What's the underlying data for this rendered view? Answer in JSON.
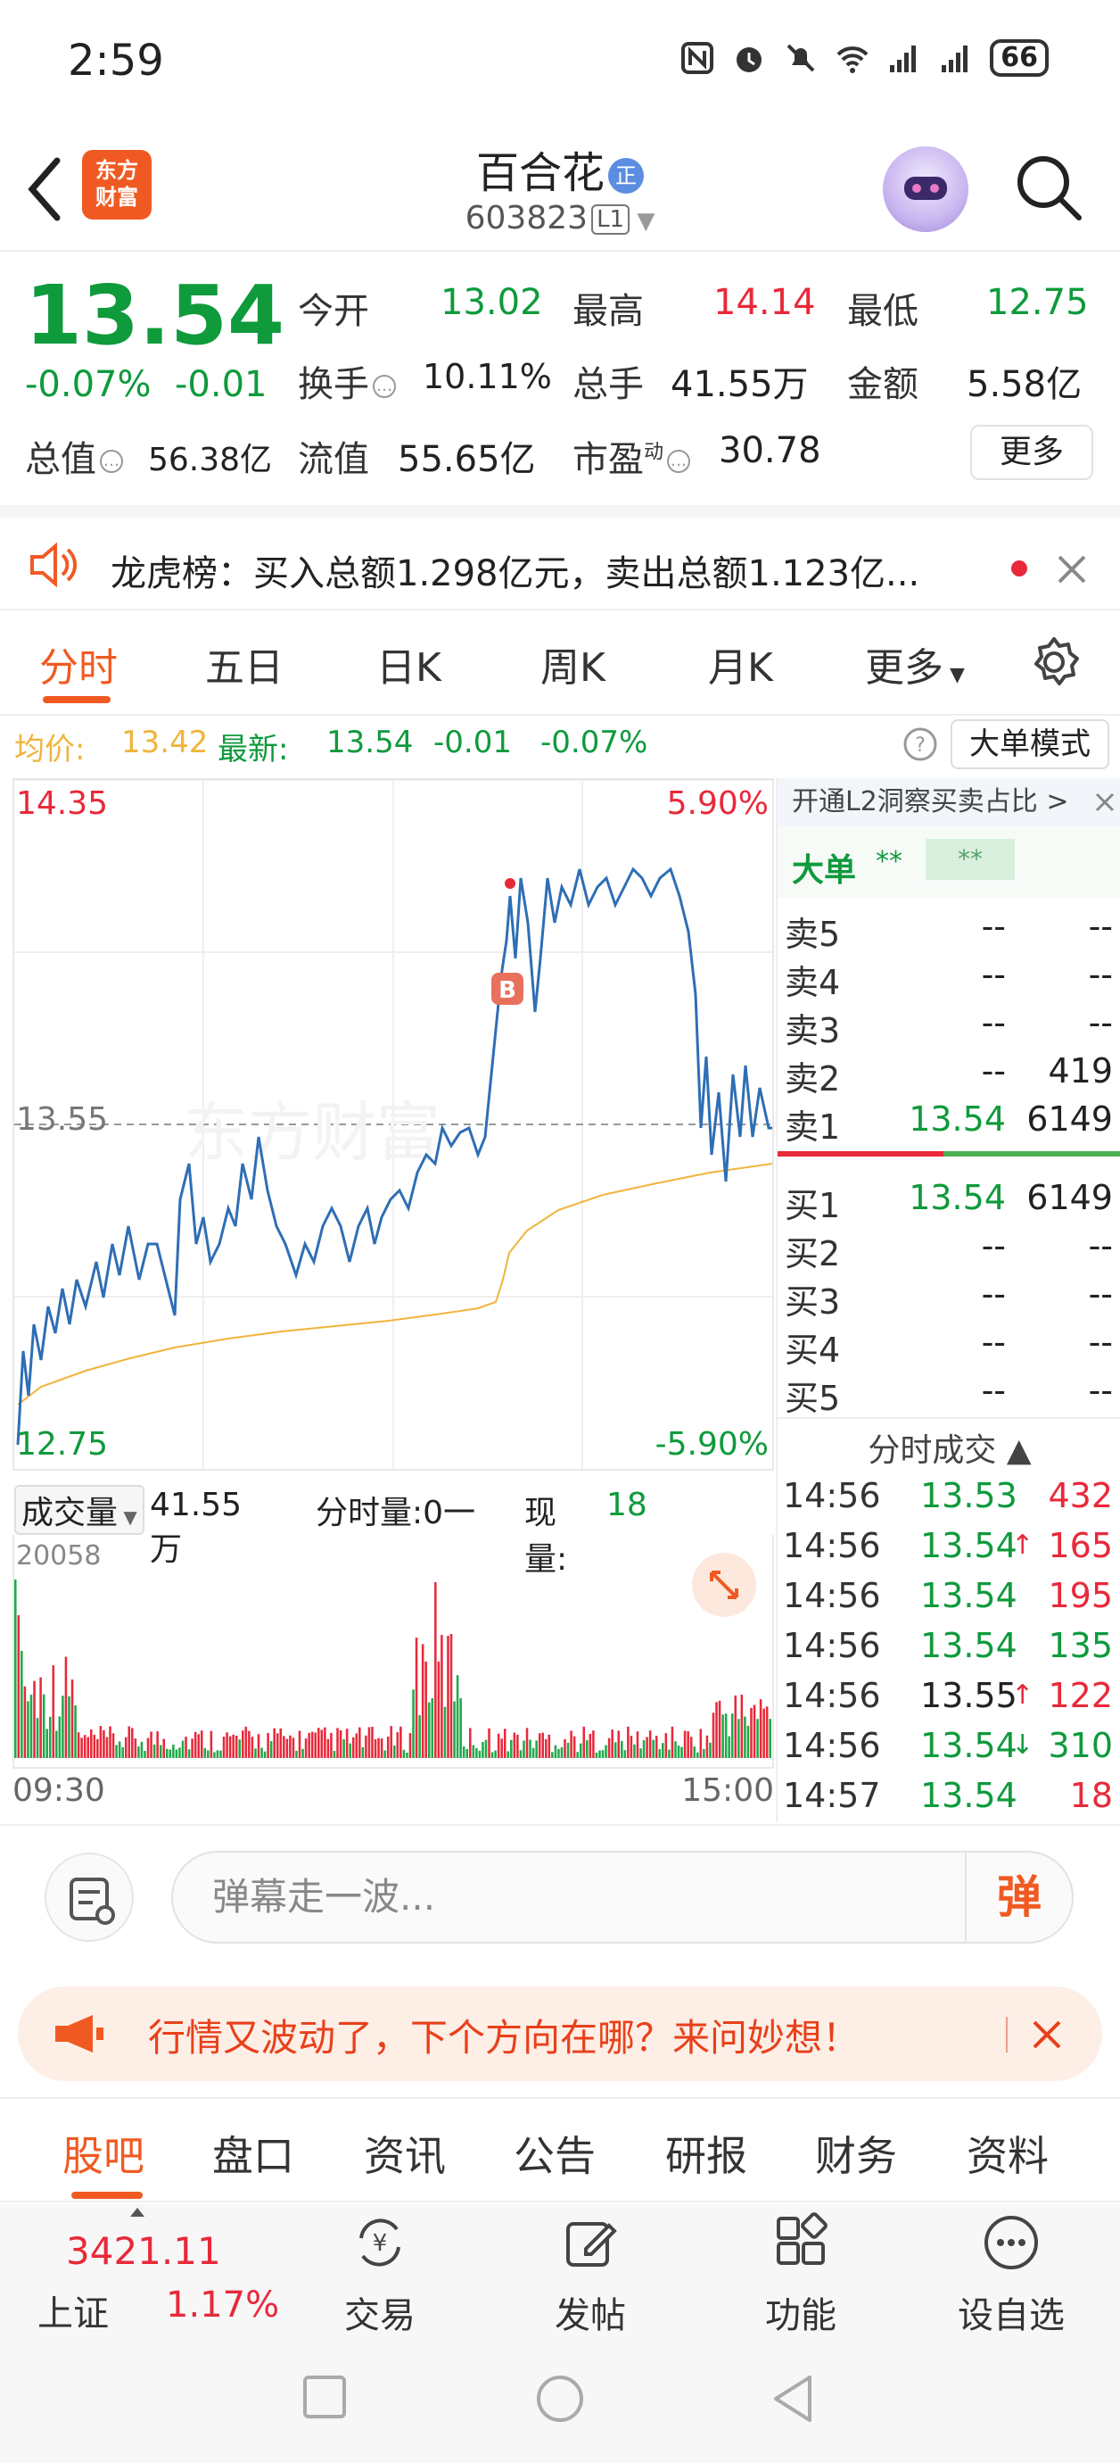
{
  "status_bar": {
    "time": "2:59",
    "battery": "66"
  },
  "header": {
    "stock_name": "百合花",
    "name_badge": "正",
    "stock_code": "603823",
    "level": "L1",
    "logo_text_line1": "东方",
    "logo_text_line2": "财富"
  },
  "quote": {
    "last_price": "13.54",
    "pct_change": "-0.07%",
    "abs_change": "-0.01",
    "open_label": "今开",
    "open": "13.02",
    "high_label": "最高",
    "high": "14.14",
    "low_label": "最低",
    "low": "12.75",
    "turnover_label": "换手",
    "turnover": "10.11%",
    "volume_label": "总手",
    "volume": "41.55万",
    "amount_label": "金额",
    "amount": "5.58亿",
    "mktcap_label": "总值",
    "mktcap": "56.38亿",
    "float_label": "流值",
    "float_cap": "55.65亿",
    "pe_label": "市盈",
    "pe_sup": "动",
    "pe": "30.78",
    "more_label": "更多"
  },
  "dragon_tiger": {
    "text": "龙虎榜：买入总额1.298亿元，卖出总额1.123亿..."
  },
  "chart_tabs": [
    "分时",
    "五日",
    "日K",
    "周K",
    "月K",
    "更多"
  ],
  "info_line": {
    "avg_label": "均价:",
    "avg": "13.42",
    "latest_label": "最新:",
    "latest": "13.54",
    "chg": "-0.01",
    "pct": "-0.07%",
    "big_order_mode": "大单模式"
  },
  "chart_labels": {
    "top_price": "14.35",
    "top_pct": "5.90%",
    "mid_price": "13.55",
    "bottom_price": "12.75",
    "bottom_pct": "-5.90%",
    "watermark": "东方财富",
    "marker": "B"
  },
  "volume": {
    "header_label": "成交量",
    "total": "41.55万",
    "period_label": "分时量:0一",
    "current_label": "现量:",
    "current": "18",
    "max_label": "20058"
  },
  "time_axis": {
    "start": "09:30",
    "end": "15:00"
  },
  "order_book": {
    "l2_banner": "开通L2洞察买卖占比 >",
    "big_order_label": "大单",
    "big_order_v1": "**",
    "big_order_v2": "**",
    "asks": [
      {
        "label": "卖5",
        "price": "--",
        "vol": "--"
      },
      {
        "label": "卖4",
        "price": "--",
        "vol": "--"
      },
      {
        "label": "卖3",
        "price": "--",
        "vol": "--"
      },
      {
        "label": "卖2",
        "price": "--",
        "vol": "419"
      },
      {
        "label": "卖1",
        "price": "13.54",
        "vol": "6149"
      }
    ],
    "bids": [
      {
        "label": "买1",
        "price": "13.54",
        "vol": "6149"
      },
      {
        "label": "买2",
        "price": "--",
        "vol": "--"
      },
      {
        "label": "买3",
        "price": "--",
        "vol": "--"
      },
      {
        "label": "买4",
        "price": "--",
        "vol": "--"
      },
      {
        "label": "买5",
        "price": "--",
        "vol": "--"
      }
    ],
    "ticks_title": "分时成交 ▲",
    "ticks": [
      {
        "time": "14:56",
        "price": "13.53",
        "arrow": "",
        "vol": "432",
        "pcolor": "green",
        "vcolor": "red"
      },
      {
        "time": "14:56",
        "price": "13.54",
        "arrow": "↑",
        "vol": "165",
        "pcolor": "green",
        "vcolor": "red"
      },
      {
        "time": "14:56",
        "price": "13.54",
        "arrow": "",
        "vol": "195",
        "pcolor": "green",
        "vcolor": "red"
      },
      {
        "time": "14:56",
        "price": "13.54",
        "arrow": "",
        "vol": "135",
        "pcolor": "green",
        "vcolor": "green"
      },
      {
        "time": "14:56",
        "price": "13.55",
        "arrow": "↑",
        "vol": "122",
        "pcolor": "dark",
        "vcolor": "red"
      },
      {
        "time": "14:56",
        "price": "13.54",
        "arrow": "↓",
        "vol": "310",
        "pcolor": "green",
        "vcolor": "green"
      },
      {
        "time": "14:57",
        "price": "13.54",
        "arrow": "",
        "vol": "18",
        "pcolor": "green",
        "vcolor": "red"
      }
    ]
  },
  "danmu": {
    "placeholder": "弹幕走一波...",
    "send_label": "弹"
  },
  "promo": {
    "text": "行情又波动了，下个方向在哪？来问妙想！"
  },
  "bottom_tabs": [
    "股吧",
    "盘口",
    "资讯",
    "公告",
    "研报",
    "财务",
    "资料"
  ],
  "dock": {
    "index_value": "3421.11",
    "index_name": "上证",
    "index_pct": "1.17%",
    "items": [
      {
        "label": "交易",
        "icon": "trade-icon"
      },
      {
        "label": "发帖",
        "icon": "post-icon"
      },
      {
        "label": "功能",
        "icon": "function-icon"
      },
      {
        "label": "设自选",
        "icon": "watchlist-icon"
      }
    ]
  },
  "colors": {
    "up": "#e8293a",
    "down": "#0f9a3c",
    "accent": "#f05a22",
    "price_line": "#2e6eb5",
    "avg_line": "#f0b43c"
  }
}
